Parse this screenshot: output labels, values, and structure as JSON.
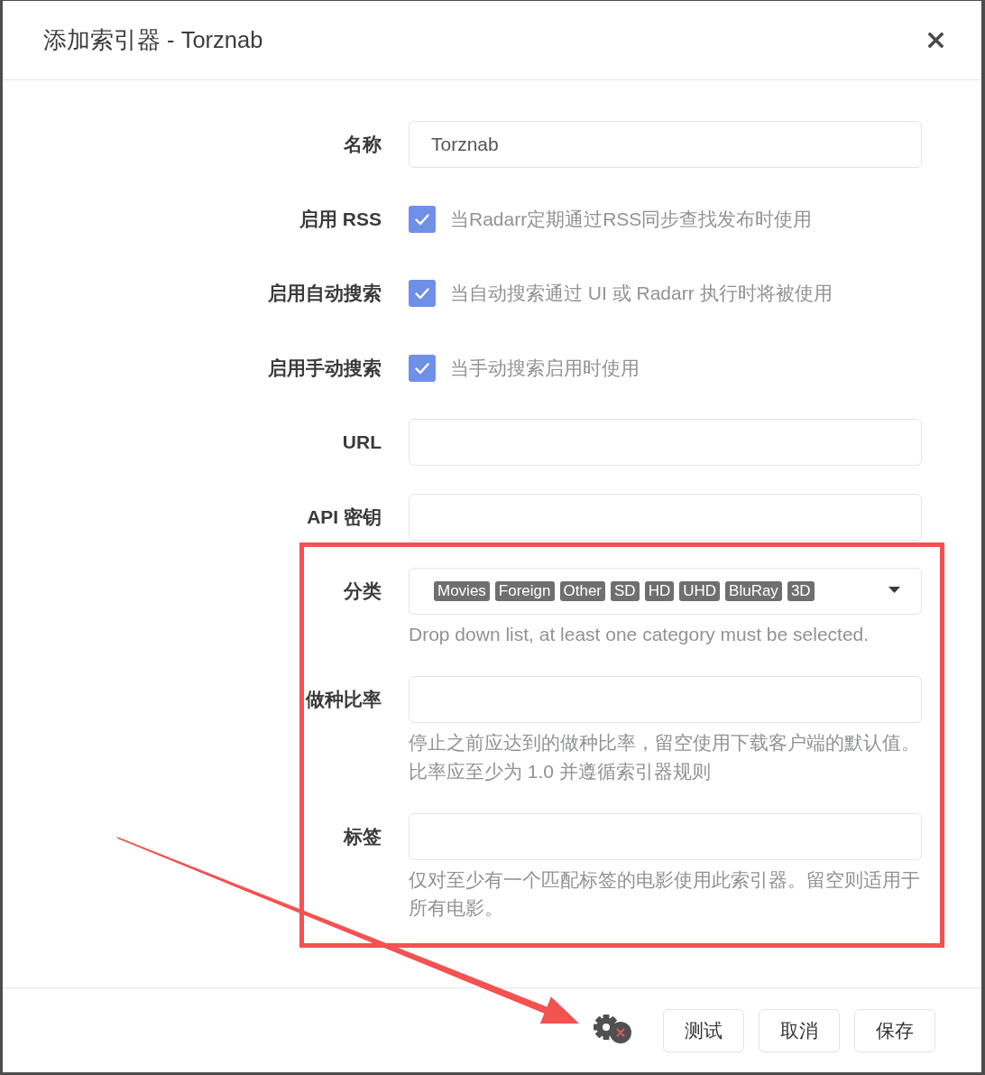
{
  "dialog": {
    "title": "添加索引器 - Torznab"
  },
  "fields": [
    {
      "kind": "text",
      "label": "名称",
      "value": "Torznab"
    },
    {
      "kind": "checkbox",
      "label": "启用 RSS",
      "checked": true,
      "help": "当Radarr定期通过RSS同步查找发布时使用"
    },
    {
      "kind": "checkbox",
      "label": "启用自动搜索",
      "checked": true,
      "help": "当自动搜索通过 UI 或 Radarr 执行时将被使用"
    },
    {
      "kind": "checkbox",
      "label": "启用手动搜索",
      "checked": true,
      "help": "当手动搜索启用时使用"
    },
    {
      "kind": "text",
      "label": "URL"
    },
    {
      "kind": "text",
      "label": "API 密钥"
    },
    {
      "kind": "tags",
      "label": "分类",
      "tags": [
        "Movies",
        "Foreign",
        "Other",
        "SD",
        "HD",
        "UHD",
        "BluRay",
        "3D"
      ],
      "help": "Drop down list, at least one category must be selected."
    },
    {
      "kind": "text",
      "label": "做种比率",
      "help": "停止之前应达到的做种比率，留空使用下载客户端的默认值。比率应至少为 1.0 并遵循索引器规则"
    },
    {
      "kind": "text",
      "label": "标签",
      "help": "仅对至少有一个匹配标签的电影使用此索引器。留空则适用于所有电影。"
    }
  ],
  "buttons": [
    "测试",
    "取消",
    "保存"
  ]
}
